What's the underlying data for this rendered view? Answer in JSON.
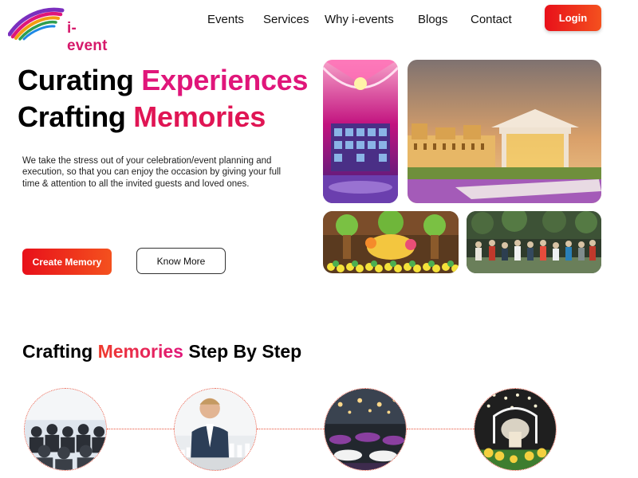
{
  "brand": {
    "name": "i-event"
  },
  "nav": {
    "items": [
      "Events",
      "Services",
      "Why i-events",
      "Blogs",
      "Contact"
    ],
    "login_label": "Login"
  },
  "hero": {
    "line1_plain": "Curating",
    "line1_accent": "Experiences",
    "line2_plain": "Crafting",
    "line2_accent": "Memories",
    "description": "We take the stress out of your celebration/event planning and execution, so that you can enjoy the occasion by giving your full time & attention to all the invited guests and loved ones.",
    "primary_button": "Create Memory",
    "secondary_button": "Know More"
  },
  "gallery": [
    {
      "name": "pink-tent-photo",
      "icon": "decorated-tent-image"
    },
    {
      "name": "palace-venue-photo",
      "icon": "palace-venue-image"
    },
    {
      "name": "kids-party-photo",
      "icon": "party-decor-image"
    },
    {
      "name": "group-event-photo",
      "icon": "outdoor-group-image"
    }
  ],
  "steps": {
    "title_start": "Crafting",
    "title_accent": "Memories",
    "title_end": "Step By Step",
    "images": [
      "conference-audience-image",
      "speaker-image",
      "banquet-hall-image",
      "decorated-stage-image"
    ]
  },
  "colors": {
    "accent_pink": "#e0167a",
    "accent_red": "#e8101a",
    "accent_orange": "#f4511e"
  }
}
